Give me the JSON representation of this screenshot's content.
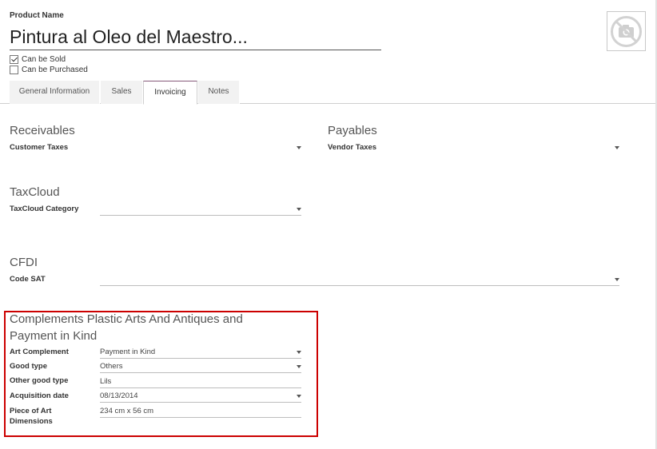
{
  "product": {
    "label": "Product Name",
    "name": "Pintura al Oleo del Maestro...",
    "photo_icon": "camera-slash-icon"
  },
  "options": {
    "can_be_sold": {
      "label": "Can be Sold",
      "checked": true
    },
    "can_be_purchased": {
      "label": "Can be Purchased",
      "checked": false
    }
  },
  "tabs": [
    {
      "label": "General Information",
      "active": false
    },
    {
      "label": "Sales",
      "active": false
    },
    {
      "label": "Invoicing",
      "active": true
    },
    {
      "label": "Notes",
      "active": false
    }
  ],
  "receivables": {
    "title": "Receivables",
    "customer_taxes_label": "Customer Taxes",
    "customer_taxes_value": ""
  },
  "payables": {
    "title": "Payables",
    "vendor_taxes_label": "Vendor Taxes",
    "vendor_taxes_value": ""
  },
  "taxcloud": {
    "title": "TaxCloud",
    "category_label": "TaxCloud Category",
    "category_value": ""
  },
  "cfdi": {
    "title": "CFDI",
    "code_sat_label": "Code SAT",
    "code_sat_value": ""
  },
  "complements": {
    "title_line1": "Complements Plastic Arts And Antiques and",
    "title_line2": "Payment in Kind",
    "art_complement_label": "Art Complement",
    "art_complement_value": "Payment in Kind",
    "good_type_label": "Good type",
    "good_type_value": "Others",
    "other_good_type_label": "Other good type",
    "other_good_type_value": "Lils",
    "acquisition_date_label": "Acquisition date",
    "acquisition_date_value": "08/13/2014",
    "piece_dimensions_label_line1": "Piece of Art",
    "piece_dimensions_label_line2": "Dimensions",
    "piece_dimensions_value": "234 cm x 56 cm"
  },
  "colors": {
    "highlight_border": "#cc0000",
    "active_tab_accent": "#875a7b"
  }
}
